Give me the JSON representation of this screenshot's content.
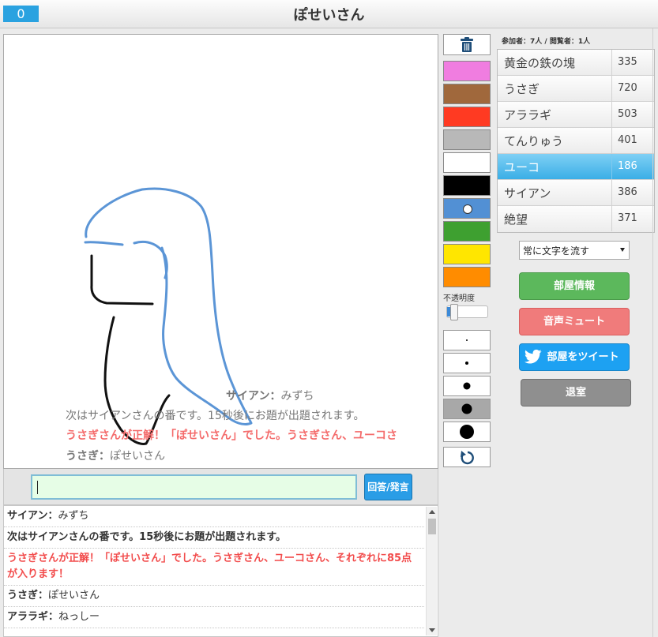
{
  "header": {
    "score": "0",
    "title": "ぽせいさん"
  },
  "canvas": {
    "messages": [
      {
        "name": "サイアン",
        "sep": "：",
        "text": "みずち"
      },
      {
        "text": "次はサイアンさんの番です。15秒後にお題が出題されます。"
      },
      {
        "text": "うさぎさんが正解！「ぽせいさん」でした。うさぎさん、ユーコさ"
      },
      {
        "name": "うさぎ",
        "sep": "：",
        "text": "ぽせいさん"
      }
    ]
  },
  "answer": {
    "value": "",
    "button_label": "回答/発言"
  },
  "chat": [
    {
      "name": "サイアン",
      "sep": "：",
      "text": "みずち"
    },
    {
      "text": "次はサイアンさんの番です。15秒後にお題が出題されます。"
    },
    {
      "text": "うさぎさんが正解！「ぽせいさん」でした。うさぎさん、ユーコさん、それぞれに85点が入ります！"
    },
    {
      "name": "うさぎ",
      "sep": "：",
      "text": "ぽせいさん"
    },
    {
      "name": "アララギ",
      "sep": "：",
      "text": "ねっしー"
    }
  ],
  "tools": {
    "colors": [
      "#f07de0",
      "#a0683c",
      "#ff3a22",
      "#b8b8b8",
      "#ffffff",
      "#000000",
      "#5290d4",
      "#3ea030",
      "#ffe600",
      "#ff8c00"
    ],
    "selected_color_index": 6,
    "opacity_label": "不透明度",
    "opacity": 0.05,
    "brush_sizes": [
      2,
      4,
      9,
      13,
      18
    ],
    "selected_brush_index": 3
  },
  "room": {
    "participants_label": "参加者：7人 / 閲覧者：1人",
    "ranking": [
      {
        "name": "黄金の鉄の塊",
        "score": "335"
      },
      {
        "name": "うさぎ",
        "score": "720"
      },
      {
        "name": "アララギ",
        "score": "503"
      },
      {
        "name": "てんりゅう",
        "score": "401"
      },
      {
        "name": "ユーコ",
        "score": "186"
      },
      {
        "name": "サイアン",
        "score": "386"
      },
      {
        "name": "絶望",
        "score": "371"
      }
    ],
    "active_index": 4,
    "flow_select": "常に文字を流す",
    "buttons": {
      "room_info": "部屋情報",
      "mute": "音声ミュート",
      "tweet": "部屋をツイート",
      "exit": "退室"
    }
  }
}
